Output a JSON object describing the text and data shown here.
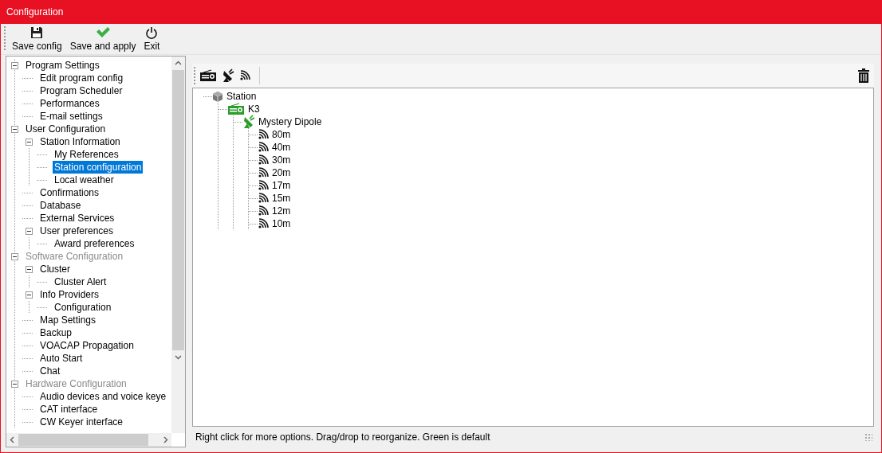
{
  "window": {
    "title": "Configuration"
  },
  "toolbar": [
    {
      "label": "Save config",
      "kind": "save"
    },
    {
      "label": "Save and apply",
      "kind": "apply"
    },
    {
      "label": "Exit",
      "kind": "exit"
    }
  ],
  "tree": {
    "items": [
      {
        "label": "Program Settings",
        "selected": false,
        "disabled": false,
        "expanded": true,
        "children": [
          {
            "label": "Edit program config",
            "selected": false
          },
          {
            "label": "Program Scheduler",
            "selected": false
          },
          {
            "label": "Performances",
            "selected": false
          },
          {
            "label": "E-mail settings",
            "selected": false
          }
        ]
      },
      {
        "label": "User Configuration",
        "selected": false,
        "disabled": false,
        "expanded": true,
        "children": [
          {
            "label": "Station Information",
            "selected": false,
            "expanded": true,
            "children": [
              {
                "label": "My References",
                "selected": false
              },
              {
                "label": "Station configuration",
                "selected": true
              },
              {
                "label": "Local weather",
                "selected": false
              }
            ]
          },
          {
            "label": "Confirmations",
            "selected": false
          },
          {
            "label": "Database",
            "selected": false
          },
          {
            "label": "External Services",
            "selected": false
          },
          {
            "label": "User preferences",
            "selected": false,
            "expanded": true,
            "children": [
              {
                "label": "Award preferences",
                "selected": false
              }
            ]
          }
        ]
      },
      {
        "label": "Software Configuration",
        "selected": false,
        "disabled": true,
        "expanded": true,
        "children": [
          {
            "label": "Cluster",
            "selected": false,
            "expanded": true,
            "children": [
              {
                "label": "Cluster Alert",
                "selected": false
              }
            ]
          },
          {
            "label": "Info Providers",
            "selected": false,
            "expanded": true,
            "children": [
              {
                "label": "Configuration",
                "selected": false
              }
            ]
          },
          {
            "label": "Map Settings",
            "selected": false
          },
          {
            "label": "Backup",
            "selected": false
          },
          {
            "label": "VOACAP Propagation",
            "selected": false
          },
          {
            "label": "Auto Start",
            "selected": false
          },
          {
            "label": "Chat",
            "selected": false
          }
        ]
      },
      {
        "label": "Hardware Configuration",
        "selected": false,
        "disabled": true,
        "expanded": true,
        "children": [
          {
            "label": "Audio devices and voice keye",
            "selected": false
          },
          {
            "label": "CAT interface",
            "selected": false
          },
          {
            "label": "CW Keyer interface",
            "selected": false
          }
        ]
      }
    ]
  },
  "station_panel": {
    "tools": [
      {
        "kind": "radio"
      },
      {
        "kind": "antenna"
      },
      {
        "kind": "band"
      }
    ],
    "tree": [
      {
        "label": "Station",
        "kind": "station",
        "children": [
          {
            "label": "K3",
            "kind": "radio",
            "default": true,
            "children": [
              {
                "label": "Mystery Dipole",
                "kind": "antenna",
                "default": true,
                "children": [
                  {
                    "label": "80m",
                    "kind": "band",
                    "default": false
                  },
                  {
                    "label": "40m",
                    "kind": "band",
                    "default": false
                  },
                  {
                    "label": "30m",
                    "kind": "band",
                    "default": false
                  },
                  {
                    "label": "20m",
                    "kind": "band",
                    "default": false
                  },
                  {
                    "label": "17m",
                    "kind": "band",
                    "default": false
                  },
                  {
                    "label": "15m",
                    "kind": "band",
                    "default": false
                  },
                  {
                    "label": "12m",
                    "kind": "band",
                    "default": false
                  },
                  {
                    "label": "10m",
                    "kind": "band",
                    "default": false
                  }
                ]
              }
            ]
          }
        ]
      }
    ],
    "status": "Right click for more options. Drag/drop to reorganize. Green is default"
  }
}
